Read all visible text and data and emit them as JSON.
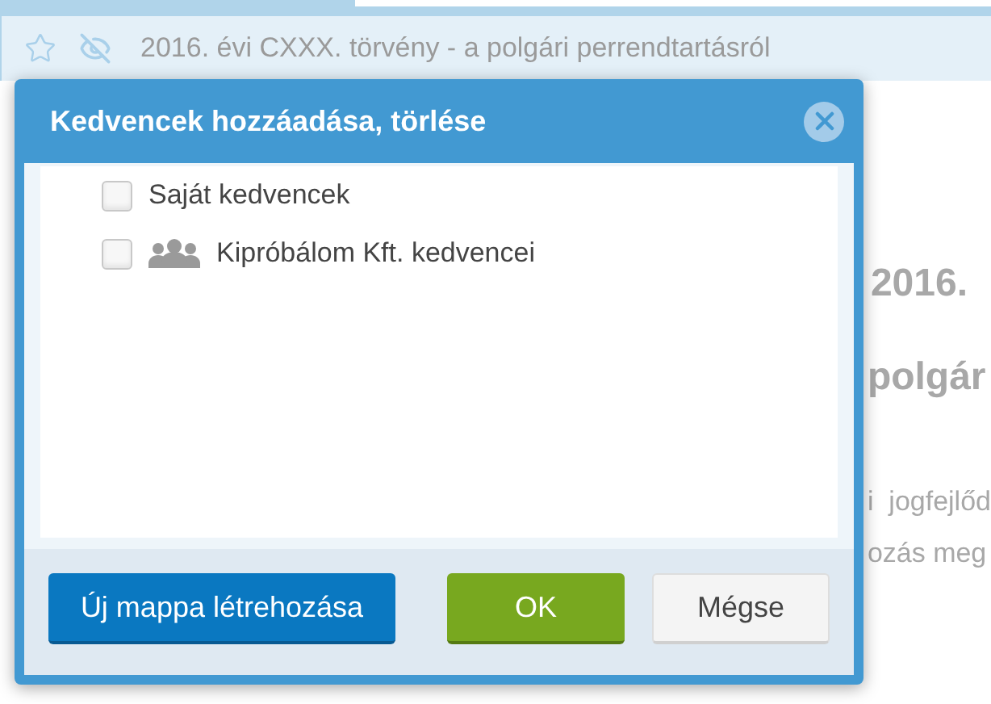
{
  "page": {
    "title": "2016. évi CXXX. törvény - a polgári perrendtartásról",
    "starred": false,
    "fragments": [
      "2016.",
      "polgár",
      "i  jogfejlőd",
      "ozás meg"
    ]
  },
  "dialog": {
    "title": "Kedvencek hozzáadása, törlése",
    "items": [
      {
        "kind": "personal",
        "label": "Saját kedvencek",
        "checked": false
      },
      {
        "kind": "shared",
        "label": "Kipróbálom Kft. kedvencei",
        "checked": false
      }
    ],
    "buttons": [
      {
        "kind": "primary",
        "label": "Új mappa létrehozása"
      },
      {
        "kind": "ok",
        "label": "OK"
      },
      {
        "kind": "cancel",
        "label": "Mégse"
      }
    ]
  }
}
